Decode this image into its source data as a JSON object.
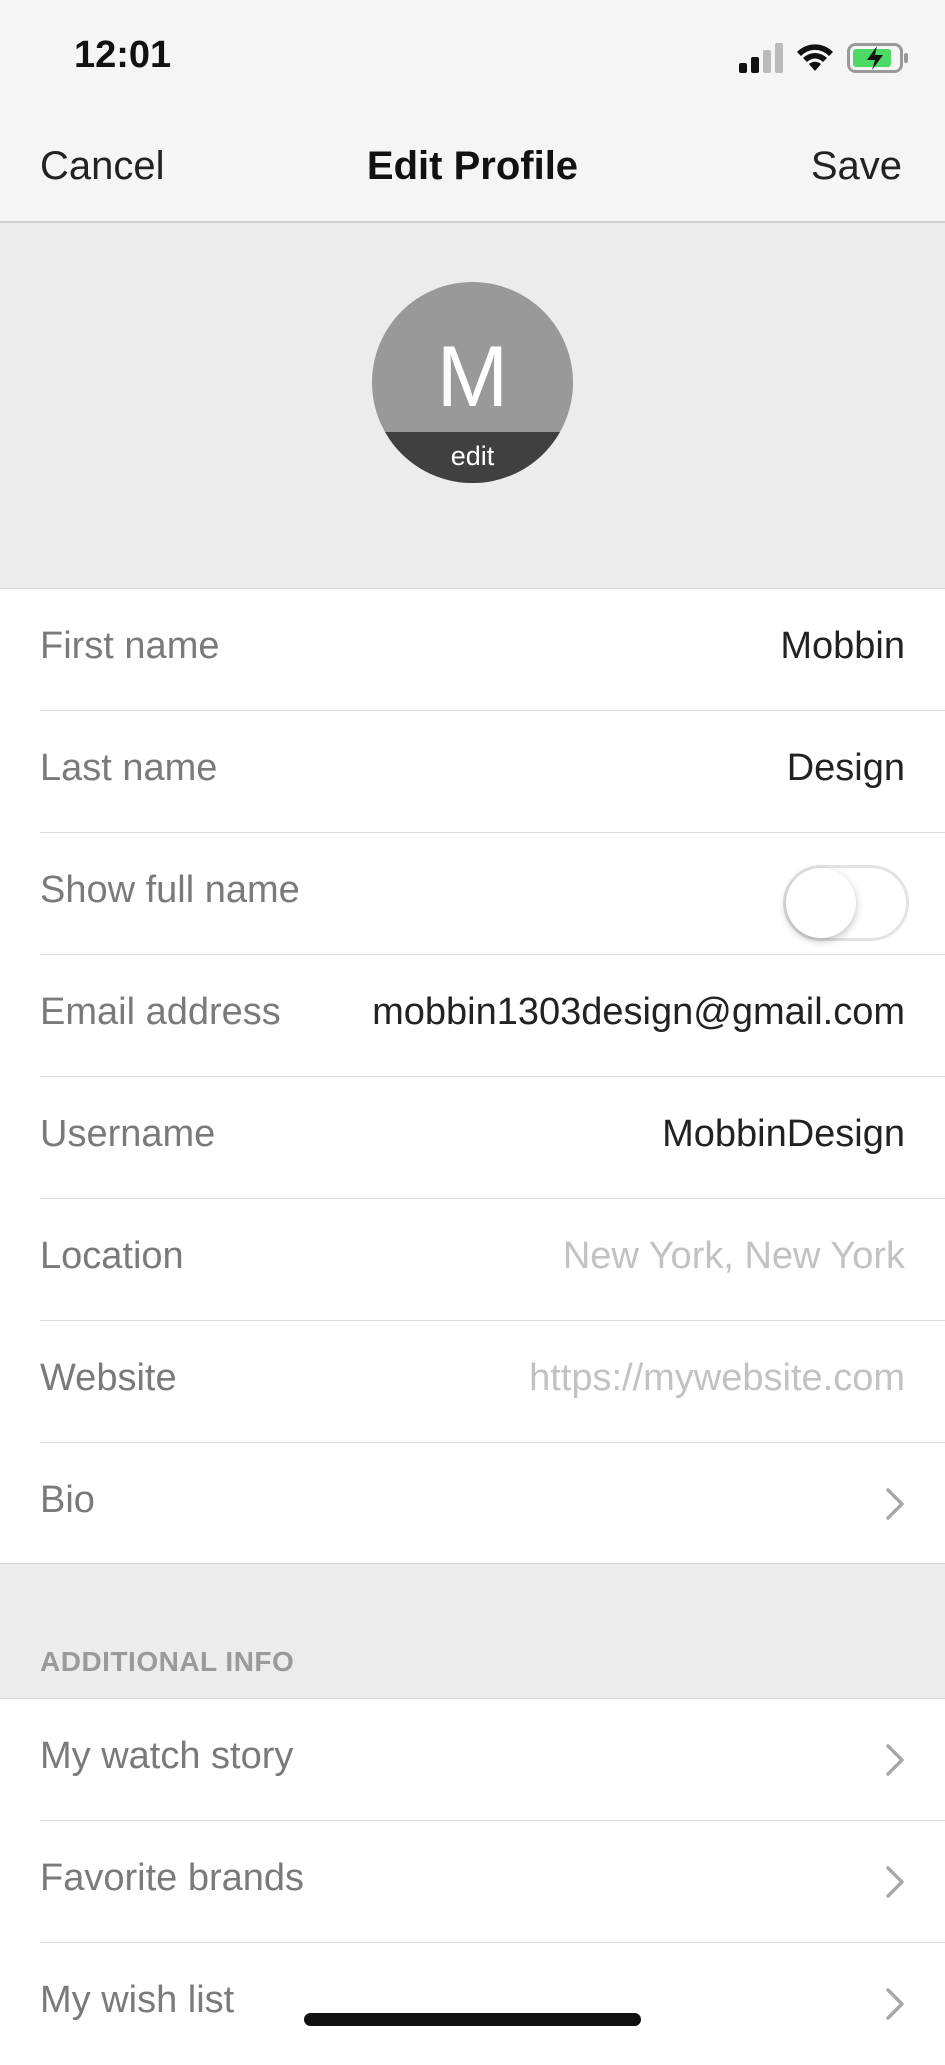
{
  "status_bar": {
    "time": "12:01"
  },
  "nav": {
    "cancel_label": "Cancel",
    "title": "Edit Profile",
    "save_label": "Save"
  },
  "avatar": {
    "letter": "M",
    "edit_label": "edit"
  },
  "profile_fields": [
    {
      "label": "First name",
      "value": "Mobbin"
    },
    {
      "label": "Last name",
      "value": "Design"
    },
    {
      "label": "Show full name",
      "toggle_on": false
    },
    {
      "label": "Email address",
      "value": "mobbin1303design@gmail.com"
    },
    {
      "label": "Username",
      "value": "MobbinDesign"
    },
    {
      "label": "Location",
      "placeholder": "New York, New York"
    },
    {
      "label": "Website",
      "placeholder": "https://mywebsite.com"
    },
    {
      "label": "Bio"
    }
  ],
  "additional_info": {
    "title": "ADDITIONAL INFO",
    "items": [
      {
        "label": "My watch story"
      },
      {
        "label": "Favorite brands"
      },
      {
        "label": "My wish list"
      }
    ]
  },
  "colors": {
    "accent": "#222222",
    "background_gray": "#ececec",
    "battery_green": "#4cd964"
  }
}
